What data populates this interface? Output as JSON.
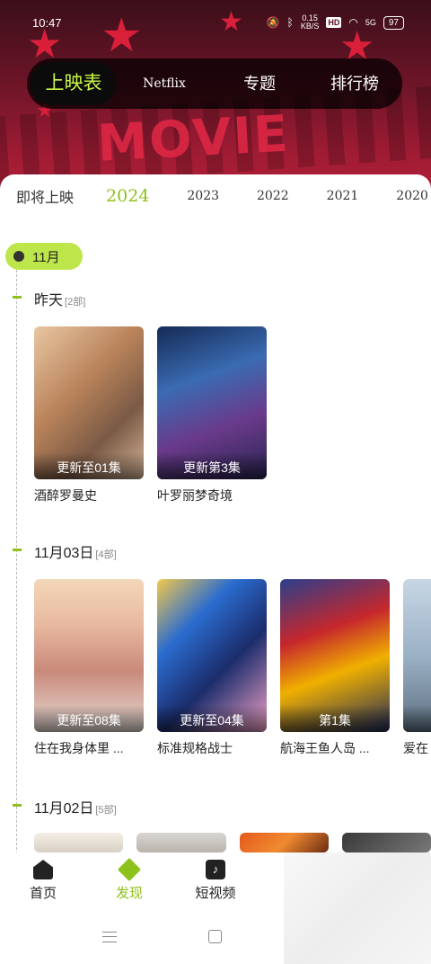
{
  "status_bar": {
    "time": "10:47",
    "speed_value": "0.15",
    "speed_unit": "KB/S",
    "hd_label": "HD",
    "signal_label": "5G",
    "battery": "97"
  },
  "hero": {
    "bg_text": "MOVIE TIME"
  },
  "top_tabs": [
    {
      "label": "上映表",
      "active": true
    },
    {
      "label": "Netflix",
      "active": false
    },
    {
      "label": "专题",
      "active": false
    },
    {
      "label": "排行榜",
      "active": false
    }
  ],
  "years": [
    "即将上映",
    "2024",
    "2023",
    "2022",
    "2021",
    "2020"
  ],
  "active_year": "2024",
  "month": "11月",
  "groups": [
    {
      "date": "昨天",
      "count": "[2部]",
      "items": [
        {
          "badge": "更新至01集",
          "title": "酒醉罗曼史"
        },
        {
          "badge": "更新第3集",
          "title": "叶罗丽梦奇境"
        }
      ]
    },
    {
      "date": "11月03日",
      "count": "[4部]",
      "items": [
        {
          "badge": "更新至08集",
          "title": "住在我身体里 ..."
        },
        {
          "badge": "更新至04集",
          "title": "标准规格战士"
        },
        {
          "badge": "第1集",
          "title": "航海王鱼人岛 ..."
        },
        {
          "badge": "更",
          "title": "爱在"
        }
      ]
    },
    {
      "date": "11月02日",
      "count": "[5部]",
      "items": []
    }
  ],
  "bottom_nav": [
    {
      "label": "首页",
      "icon": "home-icon",
      "active": false
    },
    {
      "label": "发现",
      "icon": "discover-icon",
      "active": true
    },
    {
      "label": "短视频",
      "icon": "short-video-icon",
      "active": false
    }
  ],
  "colors": {
    "accent": "#8dc11b",
    "pill": "#bde64a",
    "hero": "#9d1b33"
  }
}
